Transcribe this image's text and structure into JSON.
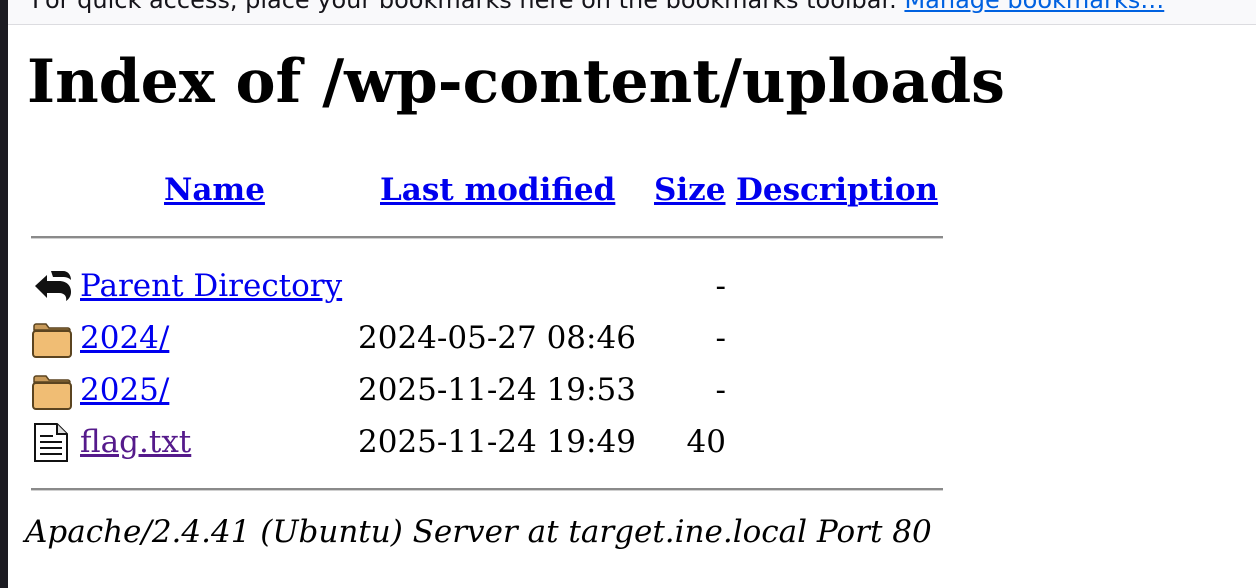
{
  "bookmarks_bar": {
    "message": "For quick access, place your bookmarks here on the bookmarks toolbar.",
    "manage_link": "Manage bookmarks…"
  },
  "page_title": "Index of /wp-content/uploads",
  "table": {
    "headers": {
      "name": "Name",
      "last_modified": "Last modified",
      "size": "Size",
      "description": "Description"
    },
    "rows": [
      {
        "icon": "back-arrow-icon",
        "name": "Parent Directory",
        "last_modified": "",
        "size": "-",
        "description": ""
      },
      {
        "icon": "folder-icon",
        "name": "2024/",
        "last_modified": "2024-05-27 08:46",
        "size": "-",
        "description": ""
      },
      {
        "icon": "folder-icon",
        "name": "2025/",
        "last_modified": "2025-11-24 19:53",
        "size": "-",
        "description": ""
      },
      {
        "icon": "text-file-icon",
        "name": "flag.txt",
        "last_modified": "2025-11-24 19:49",
        "size": "40",
        "description": ""
      }
    ]
  },
  "footer": {
    "server_signature": "Apache/2.4.41 (Ubuntu) Server at target.ine.local Port 80"
  }
}
